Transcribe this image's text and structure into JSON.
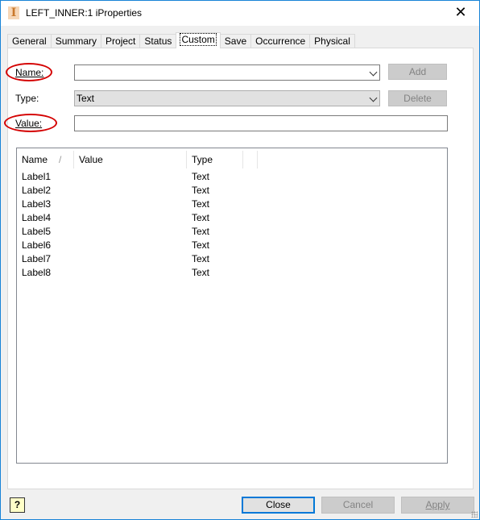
{
  "window": {
    "title": "LEFT_INNER:1 iProperties",
    "icon": "inventor-part-icon",
    "accent": "#1883d7"
  },
  "tabs": [
    {
      "label": "General"
    },
    {
      "label": "Summary"
    },
    {
      "label": "Project"
    },
    {
      "label": "Status"
    },
    {
      "label": "Custom",
      "active": true
    },
    {
      "label": "Save"
    },
    {
      "label": "Occurrence"
    },
    {
      "label": "Physical"
    }
  ],
  "form": {
    "name_label": "Name:",
    "name_value": "",
    "type_label": "Type:",
    "type_value": "Text",
    "value_label": "Value:",
    "value_value": "",
    "add_label": "Add",
    "delete_label": "Delete",
    "highlight_color": "#d40000"
  },
  "list": {
    "columns": [
      "Name",
      "Value",
      "Type"
    ],
    "rows": [
      {
        "name": "Label1",
        "value": "",
        "type": "Text"
      },
      {
        "name": "Label2",
        "value": "",
        "type": "Text"
      },
      {
        "name": "Label3",
        "value": "",
        "type": "Text"
      },
      {
        "name": "Label4",
        "value": "",
        "type": "Text"
      },
      {
        "name": "Label5",
        "value": "",
        "type": "Text"
      },
      {
        "name": "Label6",
        "value": "",
        "type": "Text"
      },
      {
        "name": "Label7",
        "value": "",
        "type": "Text"
      },
      {
        "name": "Label8",
        "value": "",
        "type": "Text"
      }
    ]
  },
  "footer": {
    "help": "?",
    "close": "Close",
    "cancel": "Cancel",
    "apply": "Apply"
  }
}
